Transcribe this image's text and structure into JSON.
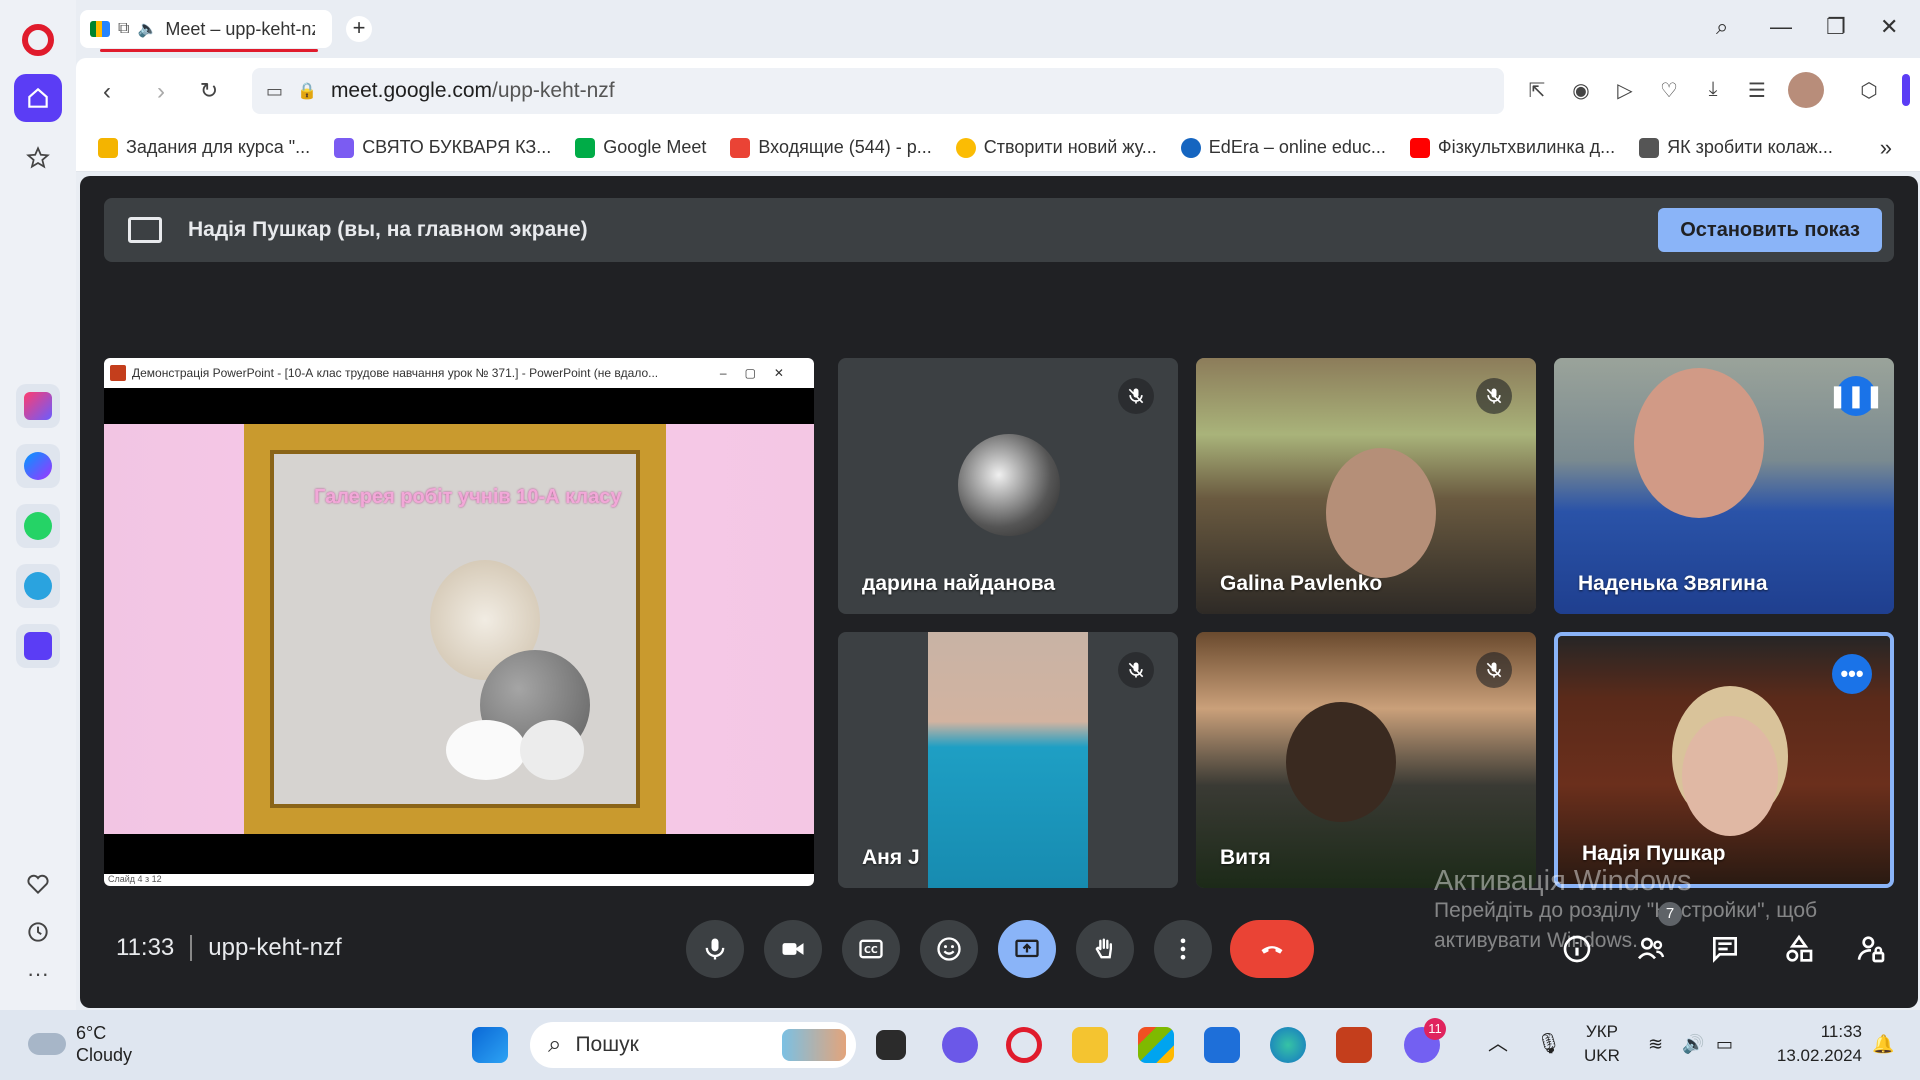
{
  "browser": {
    "tab": {
      "title": "Meet – upp-keht-nzf"
    },
    "url": {
      "host": "meet.google.com",
      "path": "/upp-keht-nzf"
    },
    "bookmarks": [
      {
        "label": "Задания для курса \"...",
        "color": "#f4b400"
      },
      {
        "label": "СВЯТО БУКВАРЯ КЗ...",
        "color": "#7b5cf2"
      },
      {
        "label": "Google Meet",
        "color": "#00ac47"
      },
      {
        "label": "Входящие (544) - p...",
        "color": "#ea4335"
      },
      {
        "label": "Створити новий жу...",
        "color": "#fbbc04"
      },
      {
        "label": "EdEra – online educ...",
        "color": "#1565c0"
      },
      {
        "label": "Фізкультхвилинка д...",
        "color": "#ff0000"
      },
      {
        "label": "ЯК зробити колаж...",
        "color": "#555555"
      }
    ]
  },
  "meet": {
    "banner": {
      "text": "Надія Пушкар (вы, на главном экране)",
      "stop_label": "Остановить показ"
    },
    "share": {
      "window_title": "Демонстрація PowerPoint - [10-А клас трудове навчання урок № 371.] - PowerPoint (не вдало...",
      "slide_title": "Галерея робіт учнів 10-А класу",
      "slide_footer": "Слайд 4 з 12"
    },
    "participants": [
      {
        "name": "дарина найданова",
        "muted": true
      },
      {
        "name": "Galina Pavlenko",
        "muted": true
      },
      {
        "name": "Наденька Звягина",
        "speaking": true
      },
      {
        "name": "Аня J",
        "muted": true
      },
      {
        "name": "Витя",
        "muted": true
      },
      {
        "name": "Надія Пушкар",
        "self": true
      }
    ],
    "time": "11:33",
    "meeting_code": "upp-keht-nzf",
    "people_count": "7",
    "watermark": {
      "title": "Активація Windows",
      "line1": "Перейдіть до розділу \"Настройки\", щоб",
      "line2": "активувати Windows."
    }
  },
  "taskbar": {
    "weather": {
      "temp": "6°C",
      "condition": "Cloudy"
    },
    "search_placeholder": "Пошук",
    "lang_top": "УКР",
    "lang_bottom": "UKR",
    "clock_time": "11:33",
    "clock_date": "13.02.2024",
    "viber_badge": "11"
  }
}
